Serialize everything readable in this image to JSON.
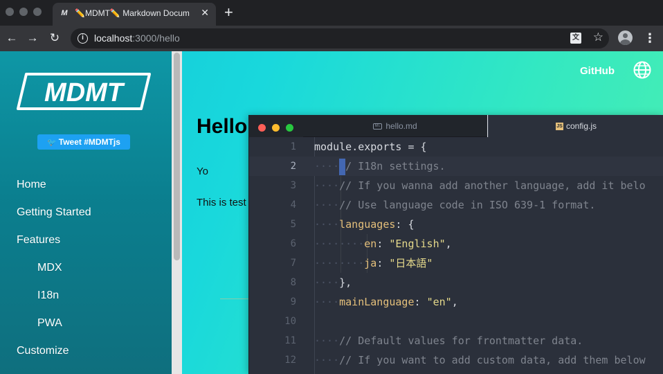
{
  "browser": {
    "tab_title": "✏️MDMT✏️ Markdown Docum",
    "tab_close": "✕",
    "new_tab": "+",
    "url_host": "localhost",
    "url_rest": ":3000/hello",
    "back": "←",
    "forward": "→",
    "reload": "↻",
    "menu": "⋮",
    "star": "☆"
  },
  "sidebar": {
    "logo_text": "MDMT",
    "tweet_label": "Tweet #MDMTjs",
    "items": [
      {
        "label": "Home"
      },
      {
        "label": "Getting Started"
      },
      {
        "label": "Features"
      },
      {
        "label": "MDX"
      },
      {
        "label": "I18n"
      },
      {
        "label": "PWA"
      },
      {
        "label": "Customize"
      }
    ]
  },
  "header": {
    "github_label": "GitHub"
  },
  "content": {
    "title": "Hello",
    "paragraph1": "Yo",
    "paragraph2": "This is test"
  },
  "editor": {
    "tabs": [
      {
        "label": "hello.md",
        "active": false
      },
      {
        "label": "config.js",
        "active": true
      }
    ],
    "lines": [
      {
        "n": "1",
        "segments": [
          [
            "c-plain",
            "module"
          ],
          [
            "c-punct",
            "."
          ],
          [
            "c-plain",
            "exports"
          ],
          [
            "c-punct",
            " = {"
          ]
        ]
      },
      {
        "n": "2",
        "current": true,
        "segments": [
          [
            "c-ws",
            "····"
          ],
          [
            "cursor",
            ""
          ],
          [
            "c-comment",
            "/ I18n settings."
          ]
        ]
      },
      {
        "n": "3",
        "segments": [
          [
            "c-ws",
            "····"
          ],
          [
            "c-comment",
            "// If you wanna add another language, add it belo"
          ]
        ]
      },
      {
        "n": "4",
        "segments": [
          [
            "c-ws",
            "····"
          ],
          [
            "c-comment",
            "// Use language code in ISO 639-1 format."
          ]
        ]
      },
      {
        "n": "5",
        "segments": [
          [
            "c-ws",
            "····"
          ],
          [
            "c-key",
            "languages"
          ],
          [
            "c-punct",
            ": {"
          ]
        ]
      },
      {
        "n": "6",
        "segments": [
          [
            "c-ws",
            "········"
          ],
          [
            "c-key",
            "en"
          ],
          [
            "c-punct",
            ": "
          ],
          [
            "c-str",
            "\"English\""
          ],
          [
            "c-punct",
            ","
          ]
        ]
      },
      {
        "n": "7",
        "segments": [
          [
            "c-ws",
            "········"
          ],
          [
            "c-key",
            "ja"
          ],
          [
            "c-punct",
            ": "
          ],
          [
            "c-str",
            "\"日本語\""
          ]
        ]
      },
      {
        "n": "8",
        "segments": [
          [
            "c-ws",
            "····"
          ],
          [
            "c-punct",
            "},"
          ]
        ]
      },
      {
        "n": "9",
        "segments": [
          [
            "c-ws",
            "····"
          ],
          [
            "c-key",
            "mainLanguage"
          ],
          [
            "c-punct",
            ": "
          ],
          [
            "c-str",
            "\"en\""
          ],
          [
            "c-punct",
            ","
          ]
        ]
      },
      {
        "n": "10",
        "segments": []
      },
      {
        "n": "11",
        "segments": [
          [
            "c-ws",
            "····"
          ],
          [
            "c-comment",
            "// Default values for frontmatter data."
          ]
        ]
      },
      {
        "n": "12",
        "segments": [
          [
            "c-ws",
            "····"
          ],
          [
            "c-comment",
            "// If you want to add custom data, add them below"
          ]
        ]
      }
    ]
  },
  "colors": {
    "accent_twitter": "#1da1f2",
    "editor_bg": "#2b303b",
    "page_gradient_start": "#12c4d8",
    "page_gradient_end": "#4cefb0"
  }
}
